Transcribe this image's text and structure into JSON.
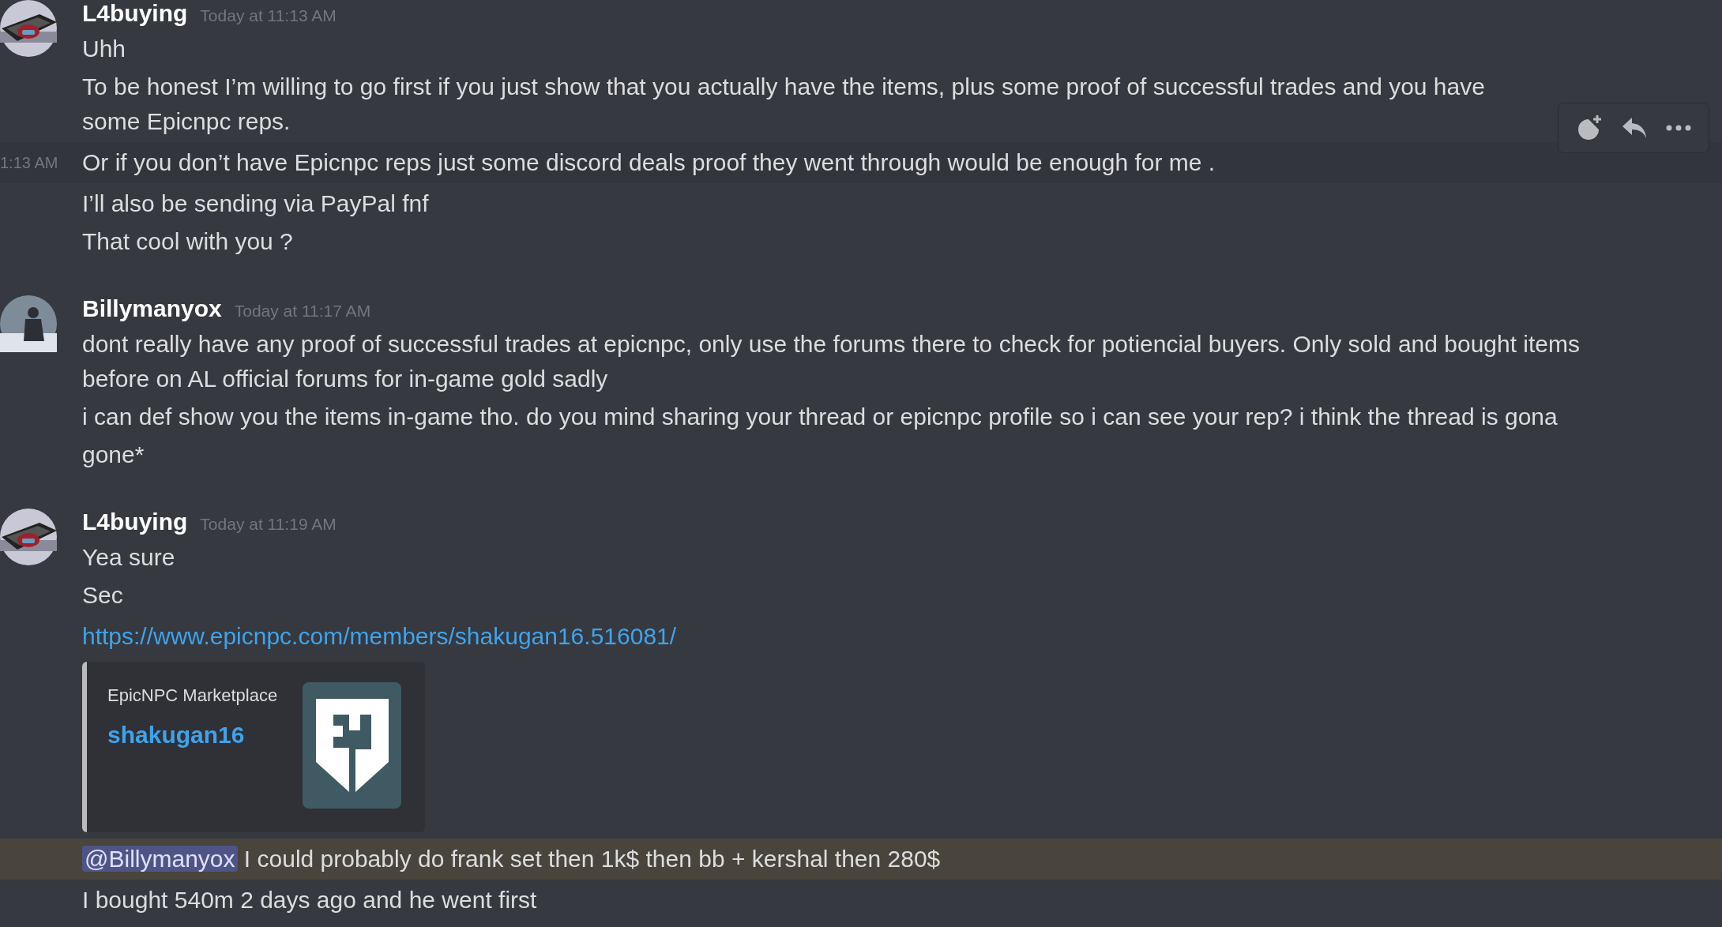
{
  "groups": [
    {
      "author": "L4buying",
      "timestamp": "Today at 11:13 AM",
      "kind": "crewmate",
      "lines": [
        {
          "kind": "text",
          "text": "Uhh",
          "hovered": false
        },
        {
          "kind": "text",
          "text": "To be honest I’m willing to go first if you just show that you actually have the items, plus some proof of successful trades and you have some Epicnpc reps.",
          "hovered": false
        },
        {
          "kind": "text",
          "text": "Or if you don’t have Epicnpc reps just some discord deals proof they went through would be enough for me .",
          "hovered": true,
          "hover_time": "1:13 AM"
        },
        {
          "kind": "text",
          "text": "I’ll also be sending via PayPal fnf",
          "hovered": false
        },
        {
          "kind": "text",
          "text": "That cool with you ?",
          "hovered": false
        }
      ]
    },
    {
      "author": "Billymanyox",
      "timestamp": "Today at 11:17 AM",
      "kind": "figure",
      "lines": [
        {
          "kind": "text",
          "text": "dont really have any proof of successful trades at epicnpc, only use the forums there to check for potiencial buyers. Only sold and bought items before on AL official forums for in-game gold sadly",
          "hovered": false
        },
        {
          "kind": "text",
          "text": "i can def show you the items in-game tho. do you mind sharing your thread or epicnpc profile so i can see your rep? i think the thread is gona",
          "hovered": false
        },
        {
          "kind": "text",
          "text": "gone*",
          "hovered": false
        }
      ]
    },
    {
      "author": "L4buying",
      "timestamp": "Today at 11:19 AM",
      "kind": "crewmate",
      "lines": [
        {
          "kind": "text",
          "text": "Yea sure",
          "hovered": false
        },
        {
          "kind": "text",
          "text": "Sec",
          "hovered": false
        },
        {
          "kind": "link",
          "text": "https://www.epicnpc.com/members/shakugan16.516081/",
          "hovered": false
        },
        {
          "kind": "embed",
          "provider": "EpicNPC Marketplace",
          "title": "shakugan16",
          "hovered": false
        },
        {
          "kind": "mention",
          "mention": "@Billymanyox",
          "text": "I could probably do frank set then 1k$ then bb + kershal then 280$",
          "hovered": false
        },
        {
          "kind": "text",
          "text": "I bought 540m 2 days ago and he went first",
          "hovered": false
        }
      ]
    }
  ]
}
